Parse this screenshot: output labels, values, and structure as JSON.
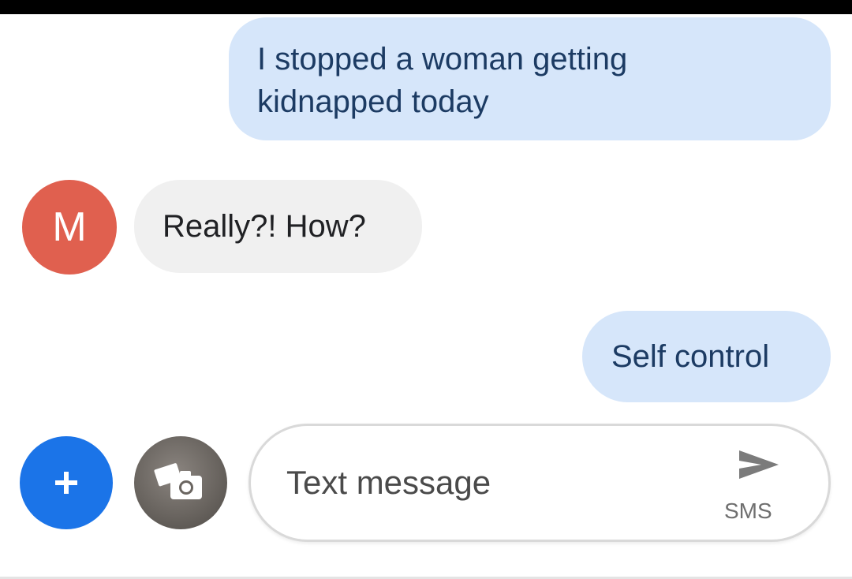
{
  "messages": [
    {
      "direction": "sent",
      "text_line1": "I stopped a woman getting",
      "text_line2": "kidnapped today"
    },
    {
      "direction": "received",
      "sender_initial": "M",
      "text": "Really?! How?"
    },
    {
      "direction": "sent",
      "text": "Self control"
    }
  ],
  "composer": {
    "placeholder": "Text message",
    "send_type_label": "SMS"
  },
  "icons": {
    "attach": "plus-icon",
    "gallery": "camera-icon",
    "send": "send-icon"
  },
  "colors": {
    "sent_bubble": "#d6e6fa",
    "received_bubble": "#f0f0f0",
    "avatar": "#e0604f",
    "attach_button": "#1b74e8"
  }
}
